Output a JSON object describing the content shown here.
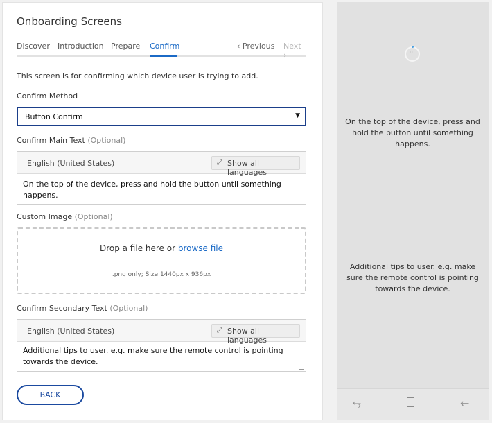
{
  "page": {
    "title": "Onboarding Screens"
  },
  "tabs": [
    {
      "label": "Discover"
    },
    {
      "label": "Introduction"
    },
    {
      "label": "Prepare"
    },
    {
      "label": "Confirm"
    }
  ],
  "pager": {
    "previous": "‹ Previous",
    "next": "Next ›"
  },
  "description": "This screen is for confirming which device user is trying to add.",
  "confirm_method": {
    "label": "Confirm Method",
    "value": "Button Confirm"
  },
  "confirm_main_text": {
    "label": "Confirm Main Text",
    "optional": "(Optional)",
    "language": "English (United States)",
    "show_all_label": "Show all languages",
    "value": "On the top of the device, press and hold the button until something happens."
  },
  "custom_image": {
    "label": "Custom Image",
    "optional": "(Optional)",
    "drop_text": "Drop a file here or",
    "browse_link": "browse file",
    "hint": ".png only; Size 1440px x 936px"
  },
  "confirm_secondary_text": {
    "label": "Confirm Secondary Text",
    "optional": "(Optional)",
    "language": "English (United States)",
    "show_all_label": "Show all languages",
    "value": "Additional tips to user. e.g. make sure the remote control is pointing towards the device."
  },
  "back_button": "BACK",
  "preview": {
    "main_text": "On the top of the device, press and hold the button until something happens.",
    "secondary_text": "Additional tips to user. e.g. make sure the remote control is pointing towards the device.",
    "spinner_glyph": "···",
    "nav_icons": [
      "recent-apps-icon",
      "home-icon",
      "back-arrow-icon"
    ]
  },
  "colors": {
    "accent": "#1b6ac6",
    "primary_border": "#1b4aa0",
    "preview_bg": "#e1e1e1"
  }
}
